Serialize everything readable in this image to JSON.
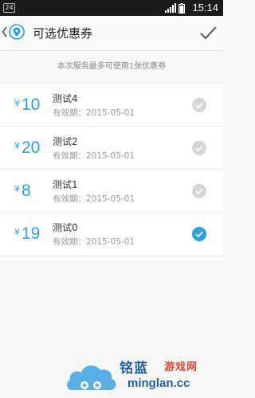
{
  "status_bar": {
    "notification_badge": "24",
    "time": "15:14",
    "icons": [
      "signal-icon",
      "battery-icon"
    ]
  },
  "header": {
    "title": "可选优惠券",
    "back_icon": "chevron-left-icon",
    "location_icon": "location-pin-icon",
    "confirm_icon": "checkmark-icon"
  },
  "hint": "本次服务最多可使用1张优惠券",
  "coupons": [
    {
      "currency": "¥",
      "amount": "10",
      "name": "测试4",
      "expire": "有效期：2015-05-01",
      "selected": false
    },
    {
      "currency": "¥",
      "amount": "20",
      "name": "测试2",
      "expire": "有效期：2015-05-01",
      "selected": false
    },
    {
      "currency": "¥",
      "amount": "8",
      "name": "测试1",
      "expire": "有效期：2015-05-01",
      "selected": false
    },
    {
      "currency": "¥",
      "amount": "19",
      "name": "测试0",
      "expire": "有效期：2015-05-01",
      "selected": true
    }
  ],
  "watermark": {
    "brand": "铭蓝",
    "sub": "游戏网",
    "domain": "minglan.cc"
  },
  "colors": {
    "accent": "#2a9ee6",
    "unselected_check": "#d6d6d6",
    "status_bar": "#1b1b1b"
  }
}
